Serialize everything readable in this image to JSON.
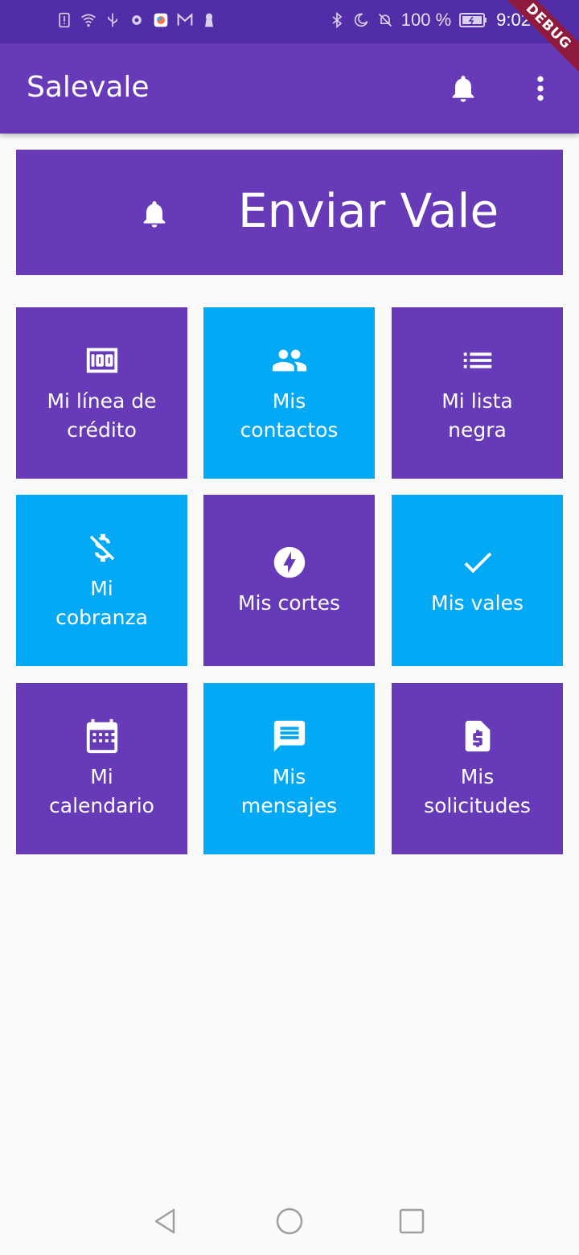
{
  "status_bar": {
    "battery_percent": "100 %",
    "time": "9:02"
  },
  "debug_label": "DEBUG",
  "app_bar": {
    "title": "Salevale"
  },
  "banner": {
    "label": "Enviar Vale"
  },
  "tiles": [
    {
      "label": "Mi línea de\ncrédito",
      "icon": "money-icon",
      "color": "#673ab7"
    },
    {
      "label": "Mis\ncontactos",
      "icon": "people-icon",
      "color": "#03a9f4"
    },
    {
      "label": "Mi lista\nnegra",
      "icon": "list-icon",
      "color": "#673ab7"
    },
    {
      "label": "Mi\ncobranza",
      "icon": "money-off-icon",
      "color": "#03a9f4"
    },
    {
      "label": "Mis cortes",
      "icon": "flash-icon",
      "color": "#673ab7"
    },
    {
      "label": "Mis vales",
      "icon": "check-icon",
      "color": "#03a9f4"
    },
    {
      "label": "Mi\ncalendario",
      "icon": "calendar-icon",
      "color": "#673ab7"
    },
    {
      "label": "Mis\nmensajes",
      "icon": "message-icon",
      "color": "#03a9f4"
    },
    {
      "label": "Mis\nsolicitudes",
      "icon": "request-quote-icon",
      "color": "#673ab7"
    }
  ],
  "colors": {
    "primary": "#673ab7",
    "primary_dark": "#512da8",
    "accent": "#03a9f4",
    "background": "#fafafa"
  }
}
